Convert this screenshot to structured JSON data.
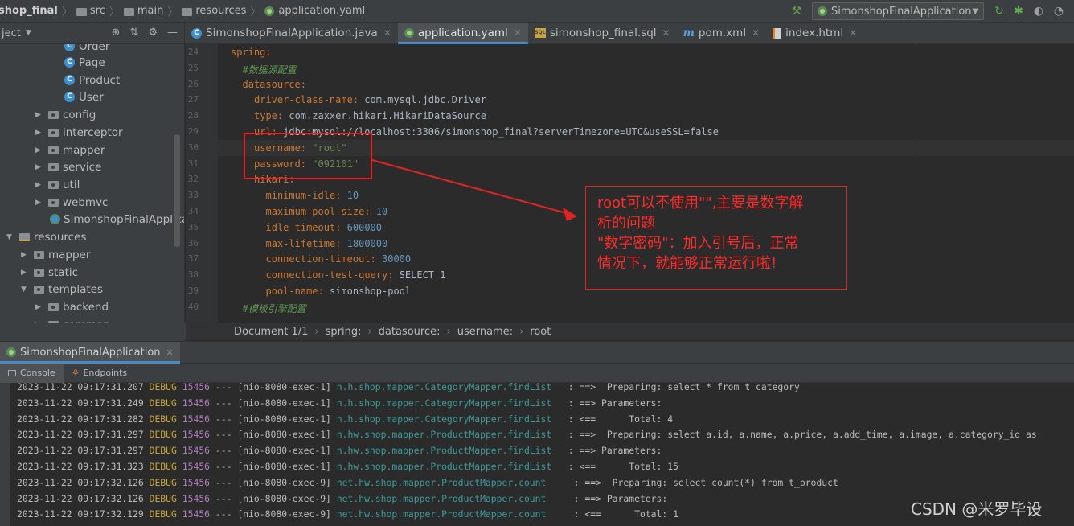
{
  "breadcrumbs": [
    "shop_final",
    "src",
    "main",
    "resources",
    "application.yaml"
  ],
  "run_config": "SimonshopFinalApplication",
  "project_label": "ject",
  "tabs": [
    {
      "label": "SimonshopFinalApplication.java",
      "icon": "class-icon"
    },
    {
      "label": "application.yaml",
      "icon": "yaml-icon",
      "active": true
    },
    {
      "label": "simonshop_final.sql",
      "icon": "sql-icon"
    },
    {
      "label": "pom.xml",
      "icon": "maven-icon"
    },
    {
      "label": "index.html",
      "icon": "html-icon"
    }
  ],
  "tree": [
    {
      "label": "Order",
      "type": "class"
    },
    {
      "label": "Page",
      "type": "class"
    },
    {
      "label": "Product",
      "type": "class"
    },
    {
      "label": "User",
      "type": "class"
    },
    {
      "label": "config",
      "type": "package"
    },
    {
      "label": "interceptor",
      "type": "package"
    },
    {
      "label": "mapper",
      "type": "package"
    },
    {
      "label": "service",
      "type": "package"
    },
    {
      "label": "util",
      "type": "package"
    },
    {
      "label": "webmvc",
      "type": "package"
    },
    {
      "label": "SimonshopFinalApplicati",
      "type": "app"
    },
    {
      "label": "resources",
      "type": "resources"
    },
    {
      "label": "mapper",
      "type": "folder"
    },
    {
      "label": "static",
      "type": "folder"
    },
    {
      "label": "templates",
      "type": "folder"
    },
    {
      "label": "backend",
      "type": "folder"
    },
    {
      "label": "common",
      "type": "folder"
    }
  ],
  "code": [
    {
      "n": "24",
      "key": "spring:",
      "val": "",
      "type": "kv"
    },
    {
      "n": "25",
      "key": "",
      "val": "#数据源配置",
      "type": "comment"
    },
    {
      "n": "26",
      "key": "datasource:",
      "val": "",
      "type": "kv"
    },
    {
      "n": "27",
      "key": "driver-class-name:",
      "val": " com.mysql.jdbc.Driver",
      "type": "kv"
    },
    {
      "n": "28",
      "key": "type:",
      "val": " com.zaxxer.hikari.HikariDataSource",
      "type": "kv"
    },
    {
      "n": "29",
      "key": "url:",
      "val": " jdbc:mysql://localhost:3306/simonshop_final?serverTimezone=UTC&useSSL=false",
      "type": "kv"
    },
    {
      "n": "30",
      "key": "username:",
      "val": " \"root\"",
      "type": "kvstr"
    },
    {
      "n": "31",
      "key": "password:",
      "val": " \"092101\"",
      "type": "kvstr"
    },
    {
      "n": "32",
      "key": "hikari:",
      "val": "",
      "type": "kv"
    },
    {
      "n": "33",
      "key": "minimum-idle:",
      "val": " 10",
      "type": "kvnum"
    },
    {
      "n": "34",
      "key": "maximum-pool-size:",
      "val": " 10",
      "type": "kvnum"
    },
    {
      "n": "35",
      "key": "idle-timeout:",
      "val": " 600000",
      "type": "kvnum"
    },
    {
      "n": "36",
      "key": "max-lifetime:",
      "val": " 1800000",
      "type": "kvnum"
    },
    {
      "n": "37",
      "key": "connection-timeout:",
      "val": " 30000",
      "type": "kvnum"
    },
    {
      "n": "38",
      "key": "connection-test-query:",
      "val": " SELECT 1",
      "type": "kv"
    },
    {
      "n": "39",
      "key": "pool-name:",
      "val": " simonshop-pool",
      "type": "kv"
    },
    {
      "n": "40",
      "key": "",
      "val": "#模板引擎配置",
      "type": "comment"
    }
  ],
  "doc_breadcrumb": [
    "Document 1/1",
    "spring:",
    "datasource:",
    "username:",
    "root"
  ],
  "run_tab": "SimonshopFinalApplication",
  "sub_tabs": [
    "Console",
    "Endpoints"
  ],
  "logs": [
    {
      "ts": "2023-11-22 09:17:31.207",
      "lvl": "DEBUG",
      "pid": "15456",
      "thread": "--- [nio-8080-exec-1]",
      "logger": "n.h.shop.mapper.CategoryMapper.findList",
      "msg": "  : ==>  Preparing: select * from t_category"
    },
    {
      "ts": "2023-11-22 09:17:31.249",
      "lvl": "DEBUG",
      "pid": "15456",
      "thread": "--- [nio-8080-exec-1]",
      "logger": "n.h.shop.mapper.CategoryMapper.findList",
      "msg": "  : ==> Parameters: "
    },
    {
      "ts": "2023-11-22 09:17:31.282",
      "lvl": "DEBUG",
      "pid": "15456",
      "thread": "--- [nio-8080-exec-1]",
      "logger": "n.h.shop.mapper.CategoryMapper.findList",
      "msg": "  : <==      Total: 4"
    },
    {
      "ts": "2023-11-22 09:17:31.297",
      "lvl": "DEBUG",
      "pid": "15456",
      "thread": "--- [nio-8080-exec-1]",
      "logger": "n.hw.shop.mapper.ProductMapper.findList",
      "msg": "  : ==>  Preparing: select a.id, a.name, a.price, a.add_time, a.image, a.category_id as"
    },
    {
      "ts": "2023-11-22 09:17:31.297",
      "lvl": "DEBUG",
      "pid": "15456",
      "thread": "--- [nio-8080-exec-1]",
      "logger": "n.hw.shop.mapper.ProductMapper.findList",
      "msg": "  : ==> Parameters: "
    },
    {
      "ts": "2023-11-22 09:17:31.323",
      "lvl": "DEBUG",
      "pid": "15456",
      "thread": "--- [nio-8080-exec-1]",
      "logger": "n.hw.shop.mapper.ProductMapper.findList",
      "msg": "  : <==      Total: 15"
    },
    {
      "ts": "2023-11-22 09:17:32.126",
      "lvl": "DEBUG",
      "pid": "15456",
      "thread": "--- [nio-8080-exec-9]",
      "logger": "net.hw.shop.mapper.ProductMapper.count  ",
      "msg": "  : ==>  Preparing: select count(*) from t_product"
    },
    {
      "ts": "2023-11-22 09:17:32.126",
      "lvl": "DEBUG",
      "pid": "15456",
      "thread": "--- [nio-8080-exec-9]",
      "logger": "net.hw.shop.mapper.ProductMapper.count  ",
      "msg": "  : ==> Parameters: "
    },
    {
      "ts": "2023-11-22 09:17:32.129",
      "lvl": "DEBUG",
      "pid": "15456",
      "thread": "--- [nio-8080-exec-9]",
      "logger": "net.hw.shop.mapper.ProductMapper.count  ",
      "msg": "  : <==      Total: 1"
    }
  ],
  "annotation": {
    "line1": "root可以不使用\"\",主要是数字解",
    "line2": "析的问题",
    "line3": "\"数字密码\"：加入引号后，正常",
    "line4": "情况下，就能够正常运行啦!"
  },
  "watermark": "CSDN @米罗毕设",
  "colors": {
    "annotation": "#e02424",
    "accent": "#4a88c7"
  }
}
